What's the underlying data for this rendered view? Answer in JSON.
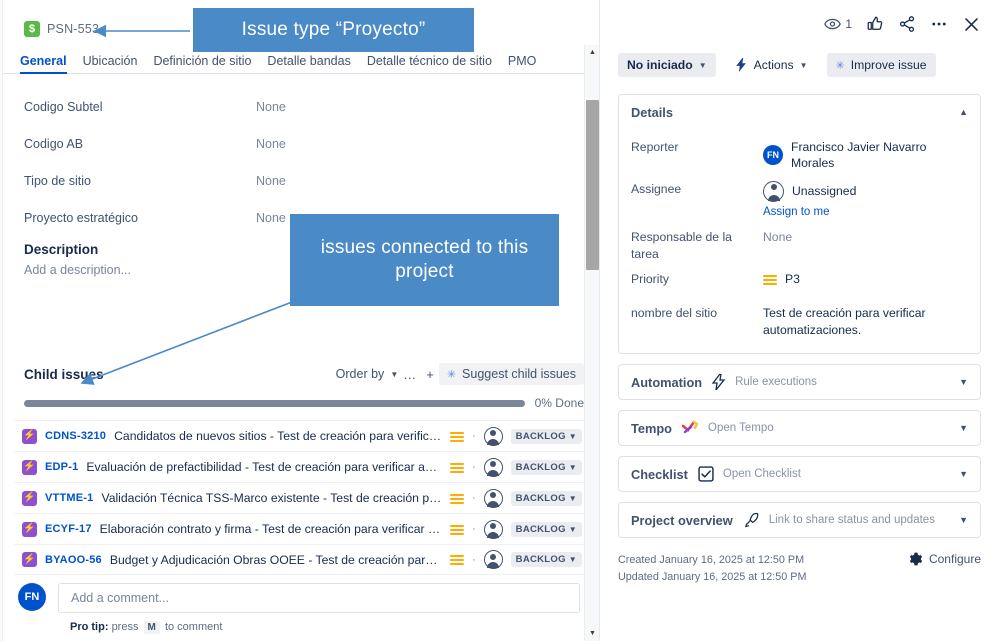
{
  "issue": {
    "key": "PSN-553",
    "project_icon": "$",
    "tabs": [
      {
        "label": "General",
        "active": true
      },
      {
        "label": "Ubicación",
        "active": false
      },
      {
        "label": "Definición de sitio",
        "active": false
      },
      {
        "label": "Detalle bandas",
        "active": false
      },
      {
        "label": "Detalle técnico de sitio",
        "active": false
      },
      {
        "label": "PMO",
        "active": false
      }
    ],
    "fields": [
      {
        "label": "Codigo Subtel",
        "value": "None"
      },
      {
        "label": "Codigo AB",
        "value": "None"
      },
      {
        "label": "Tipo de sitio",
        "value": "None"
      },
      {
        "label": "Proyecto estratégico",
        "value": "None"
      }
    ],
    "description": {
      "heading": "Description",
      "placeholder": "Add a description..."
    }
  },
  "child_issues": {
    "title": "Child issues",
    "order_by_label": "Order by",
    "more_label": "…",
    "add_label": "+",
    "suggest_label": "Suggest child issues",
    "progress_percent": 0,
    "progress_label": "0% Done",
    "rows": [
      {
        "key": "CDNS-3210",
        "summary": "Candidatos de nuevos sitios - Test de creación para verificar autom...",
        "priority": "medium",
        "assignee": "Unassigned",
        "status": "BACKLOG"
      },
      {
        "key": "EDP-1",
        "summary": "Evaluación de prefactibilidad - Test de creación para verificar automatiz...",
        "priority": "medium",
        "assignee": "Unassigned",
        "status": "BACKLOG"
      },
      {
        "key": "VTTME-1",
        "summary": "Validación Técnica TSS-Marco existente - Test de creación para verific...",
        "priority": "medium",
        "assignee": "Unassigned",
        "status": "BACKLOG"
      },
      {
        "key": "ECYF-17",
        "summary": "Elaboración contrato y firma - Test de creación para verificar automati...",
        "priority": "medium",
        "assignee": "Unassigned",
        "status": "BACKLOG"
      },
      {
        "key": "BYAOO-56",
        "summary": "Budget y Adjudicación Obras OOEE - Test de creación para verificar ...",
        "priority": "medium",
        "assignee": "Unassigned",
        "status": "BACKLOG"
      }
    ]
  },
  "comment": {
    "avatar_initials": "FN",
    "placeholder": "Add a comment...",
    "protip_prefix": "Pro tip:",
    "protip_press": "press",
    "protip_key": "M",
    "protip_suffix": "to comment"
  },
  "toolbar": {
    "watchers_count": "1",
    "status_label": "No iniciado",
    "actions_label": "Actions",
    "improve_label": "Improve issue"
  },
  "details": {
    "header": "Details",
    "rows": [
      {
        "label": "Reporter",
        "type": "person",
        "initials": "FN",
        "value": "Francisco Javier Navarro Morales"
      },
      {
        "label": "Assignee",
        "type": "assignee",
        "value": "Unassigned",
        "link": "Assign to me"
      },
      {
        "label": "Responsable de la tarea",
        "type": "none",
        "value": "None"
      },
      {
        "label": "Priority",
        "type": "priority",
        "value": "P3"
      },
      {
        "label": "nombre del sitio",
        "type": "text",
        "value": "Test de creación para verificar automatizaciones."
      }
    ]
  },
  "panels": [
    {
      "name": "Automation",
      "icon": "automation-bolt-icon",
      "text": "Rule executions"
    },
    {
      "name": "Tempo",
      "icon": "tempo-icon",
      "text": "Open Tempo"
    },
    {
      "name": "Checklist",
      "icon": "checklist-checkbox-icon",
      "text": "Open Checklist"
    },
    {
      "name": "Project overview",
      "icon": "rocket-icon",
      "text": "Link to share status and updates"
    }
  ],
  "footer": {
    "created": "Created January 16, 2025 at 12:50 PM",
    "updated": "Updated January 16, 2025 at 12:50 PM",
    "configure": "Configure"
  },
  "annotations": [
    {
      "id": "anno1",
      "text": "Issue type “Proyecto”"
    },
    {
      "id": "anno2",
      "text": "issues connected to this project"
    }
  ],
  "colors": {
    "annotation_blue": "#4a8ac7",
    "link_blue": "#0052cc",
    "project_green": "#5aba47",
    "child_type_purple": "#8f4fd1",
    "priority_amber": "#ffab00"
  }
}
